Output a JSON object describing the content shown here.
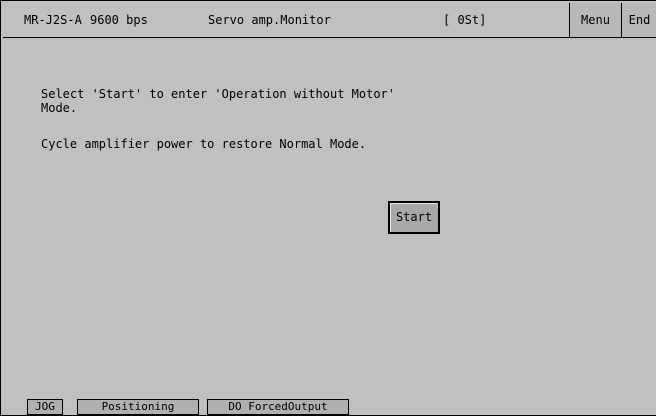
{
  "titlebar": {
    "model": "MR-J2S-A",
    "baud": "9600 bps",
    "screen_name": "Servo amp.Monitor",
    "mode": "[ 0St]",
    "menu_label": "Menu",
    "end_label": "End"
  },
  "main": {
    "message_line1": "Select 'Start' to enter 'Operation without Motor'",
    "message_line2": "Mode.",
    "message_line3": "Cycle amplifier power to restore Normal Mode.",
    "start_label": "Start"
  },
  "bottom": {
    "buttons": [
      {
        "label": "JOG"
      },
      {
        "label": "Positioning"
      },
      {
        "label": "DO ForcedOutput"
      }
    ]
  }
}
